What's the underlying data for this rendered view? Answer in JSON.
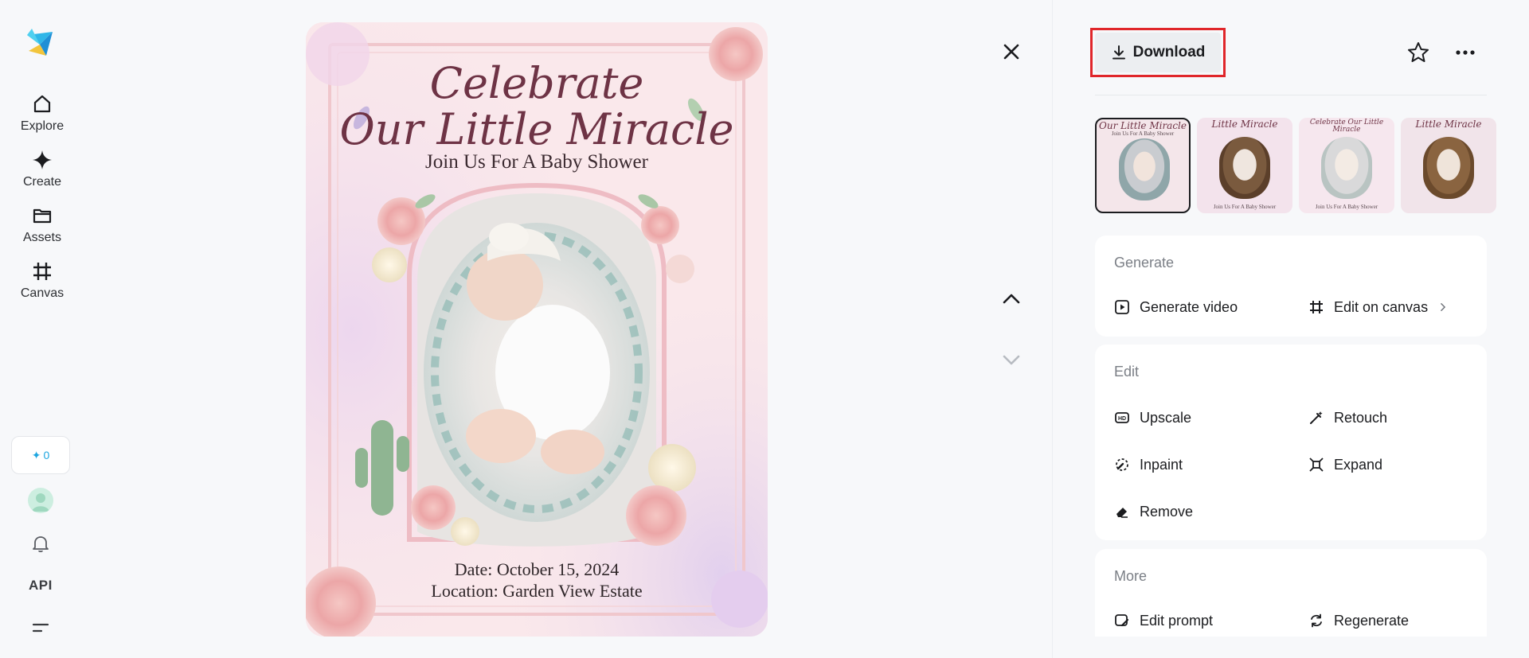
{
  "nav": {
    "items": [
      {
        "label": "Explore",
        "icon": "home-icon"
      },
      {
        "label": "Create",
        "icon": "sparkle-icon"
      },
      {
        "label": "Assets",
        "icon": "folder-icon"
      },
      {
        "label": "Canvas",
        "icon": "canvas-frame-icon"
      }
    ],
    "credits": "0",
    "api_label": "API"
  },
  "poster": {
    "title_line1": "Celebrate",
    "title_line2": "Our Little Miracle",
    "subtitle": "Join Us For A Baby Shower",
    "date_line": "Date: October 15, 2024",
    "location_line": "Location: Garden View Estate"
  },
  "toolbar": {
    "download_label": "Download"
  },
  "thumbnails": [
    {
      "title": "Our Little Miracle",
      "sub": "Join Us For A Baby Shower",
      "selected": true
    },
    {
      "title": "Little Miracle",
      "sub": "Join Us For A Baby Shower",
      "selected": false
    },
    {
      "title": "Celebrate Our Little Miracle",
      "sub": "Join Us For A Baby Shower",
      "selected": false
    },
    {
      "title": "Little Miracle",
      "sub": "",
      "selected": false
    }
  ],
  "panel": {
    "generate": {
      "title": "Generate",
      "generate_video": "Generate video",
      "edit_on_canvas": "Edit on canvas"
    },
    "edit": {
      "title": "Edit",
      "upscale": "Upscale",
      "retouch": "Retouch",
      "inpaint": "Inpaint",
      "expand": "Expand",
      "remove": "Remove"
    },
    "more": {
      "title": "More",
      "edit_prompt": "Edit prompt",
      "regenerate": "Regenerate"
    }
  },
  "colors": {
    "accent_red": "#e0262a",
    "title_plum": "#6e3345",
    "brand_blue": "#1ea6e0"
  }
}
